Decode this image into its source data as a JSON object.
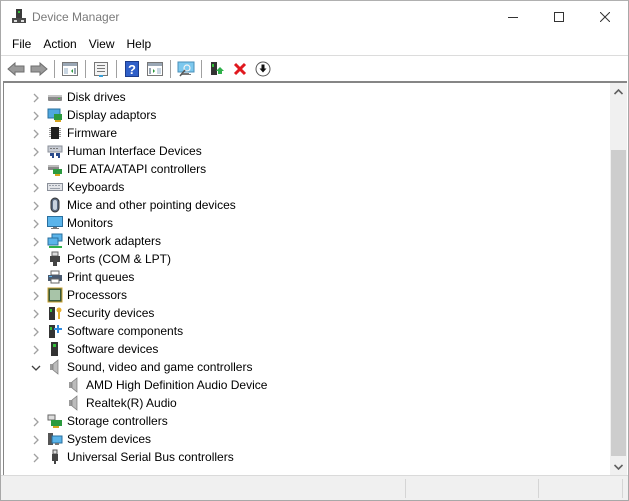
{
  "window": {
    "title": "Device Manager",
    "app_icon": "device-manager-icon",
    "controls": {
      "minimize": "minimize",
      "maximize": "maximize",
      "close": "close"
    }
  },
  "menu": [
    {
      "label": "File"
    },
    {
      "label": "Action"
    },
    {
      "label": "View"
    },
    {
      "label": "Help"
    }
  ],
  "toolbar": {
    "buttons": [
      {
        "name": "back",
        "icon": "back-arrow-icon",
        "enabled": true
      },
      {
        "name": "forward",
        "icon": "forward-arrow-icon",
        "enabled": true
      },
      {
        "name": "show-hide-console-tree",
        "icon": "console-tree-icon"
      },
      {
        "name": "properties",
        "icon": "properties-icon"
      },
      {
        "name": "help",
        "icon": "help-icon"
      },
      {
        "name": "show-hide-action-pane",
        "icon": "action-pane-icon"
      },
      {
        "name": "scan-hardware-changes",
        "icon": "scan-monitor-icon"
      },
      {
        "name": "update-driver",
        "icon": "update-driver-icon"
      },
      {
        "name": "uninstall-device",
        "icon": "uninstall-x-icon"
      },
      {
        "name": "disable-device",
        "icon": "disable-down-arrow-icon"
      }
    ]
  },
  "tree": {
    "nodes": [
      {
        "label": "Disk drives",
        "icon": "disk-drive-icon",
        "expanded": false
      },
      {
        "label": "Display adaptors",
        "icon": "display-adapter-icon",
        "expanded": false
      },
      {
        "label": "Firmware",
        "icon": "firmware-chip-icon",
        "expanded": false
      },
      {
        "label": "Human Interface Devices",
        "icon": "hid-icon",
        "expanded": false
      },
      {
        "label": "IDE ATA/ATAPI controllers",
        "icon": "ide-controller-icon",
        "expanded": false
      },
      {
        "label": "Keyboards",
        "icon": "keyboard-icon",
        "expanded": false
      },
      {
        "label": "Mice and other pointing devices",
        "icon": "mouse-icon",
        "expanded": false
      },
      {
        "label": "Monitors",
        "icon": "monitor-icon",
        "expanded": false
      },
      {
        "label": "Network adapters",
        "icon": "network-adapter-icon",
        "expanded": false
      },
      {
        "label": "Ports (COM & LPT)",
        "icon": "port-icon",
        "expanded": false
      },
      {
        "label": "Print queues",
        "icon": "printer-icon",
        "expanded": false
      },
      {
        "label": "Processors",
        "icon": "processor-icon",
        "expanded": false
      },
      {
        "label": "Security devices",
        "icon": "security-device-icon",
        "expanded": false
      },
      {
        "label": "Software components",
        "icon": "software-component-icon",
        "expanded": false
      },
      {
        "label": "Software devices",
        "icon": "software-device-icon",
        "expanded": false
      },
      {
        "label": "Sound, video and game controllers",
        "icon": "speaker-icon",
        "expanded": true,
        "children": [
          {
            "label": "AMD High Definition Audio Device",
            "icon": "speaker-icon"
          },
          {
            "label": "Realtek(R) Audio",
            "icon": "speaker-icon"
          }
        ]
      },
      {
        "label": "Storage controllers",
        "icon": "storage-controller-icon",
        "expanded": false
      },
      {
        "label": "System devices",
        "icon": "system-device-icon",
        "expanded": false
      },
      {
        "label": "Universal Serial Bus controllers",
        "icon": "usb-icon",
        "expanded": false
      }
    ]
  },
  "scrollbar": {
    "position_fraction": 1.0
  },
  "statusbar": {
    "panes": [
      "",
      "",
      ""
    ]
  }
}
